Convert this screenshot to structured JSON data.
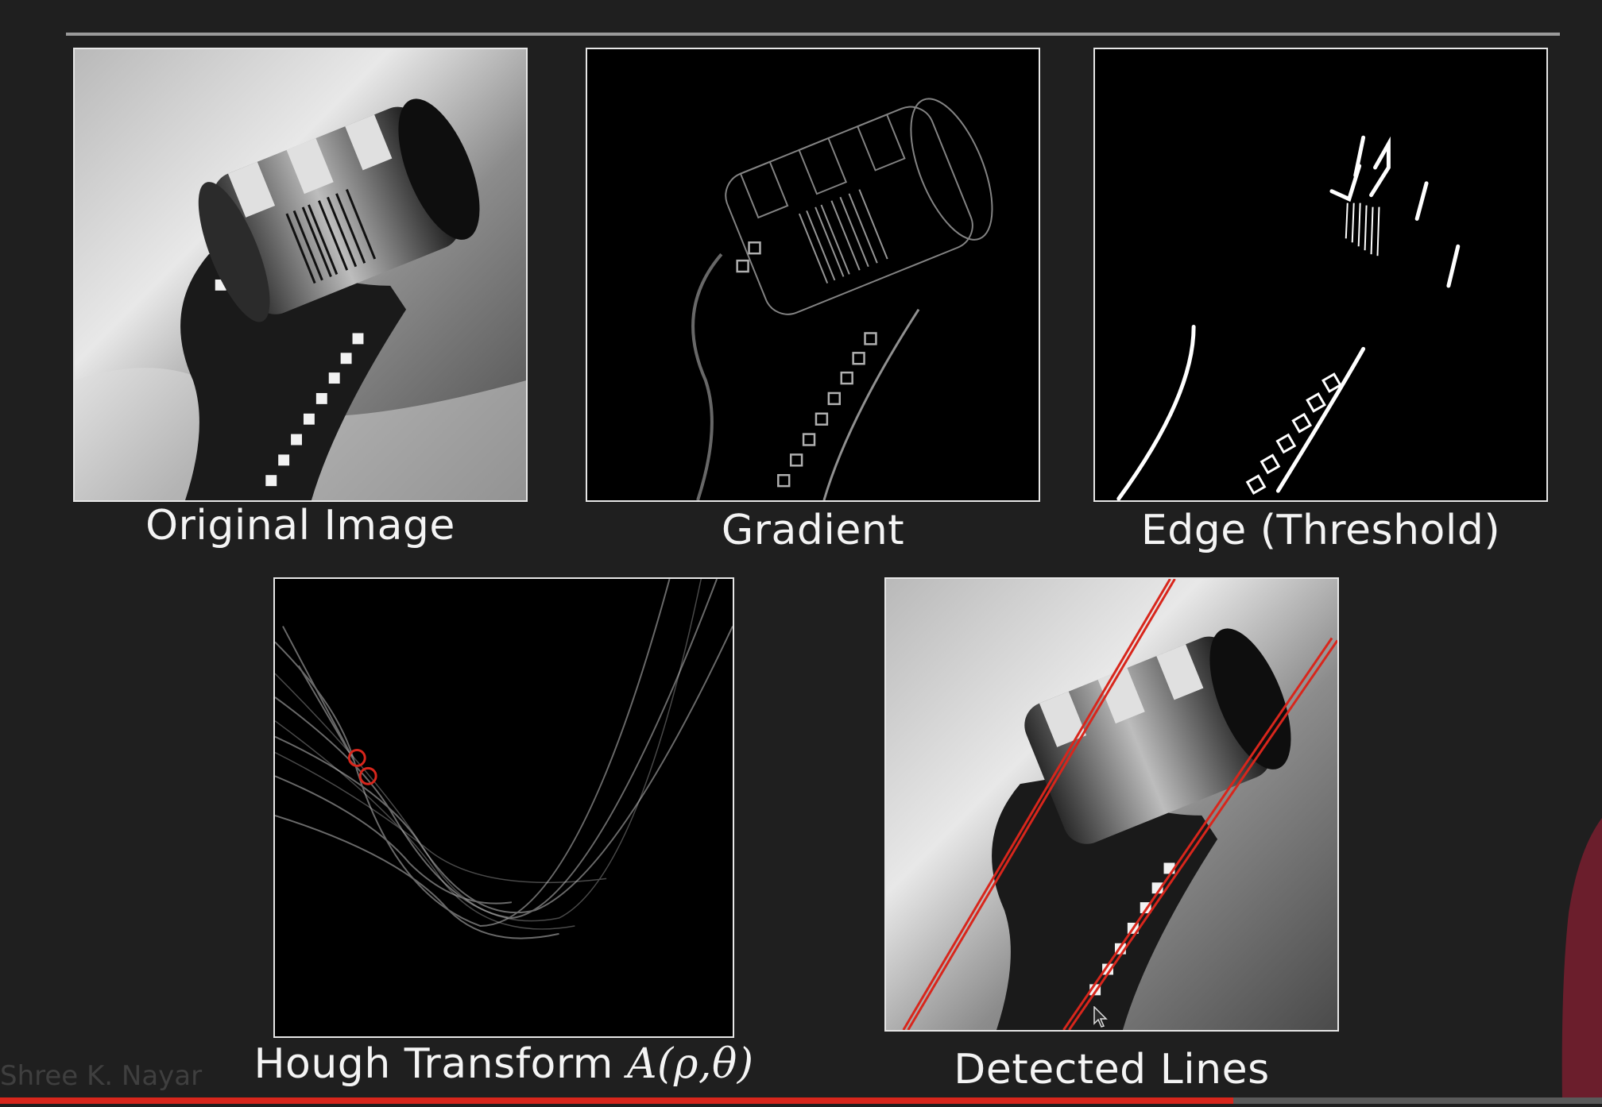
{
  "panels": {
    "original": {
      "caption": "Original Image"
    },
    "gradient": {
      "caption": "Gradient"
    },
    "edge": {
      "caption": "Edge (Threshold)"
    },
    "hough": {
      "caption_text": "Hough Transform ",
      "caption_math": "A(ρ,θ)"
    },
    "detected": {
      "caption": "Detected Lines"
    }
  },
  "watermark": "Shree K. Nayar",
  "progress": {
    "played_fraction": 0.77
  },
  "colors": {
    "background": "#1f1f1f",
    "accent": "#d8261c",
    "frame": "#e6e6e6"
  },
  "icons": {
    "cursor": "cursor-icon",
    "presenter": "presenter-silhouette"
  }
}
